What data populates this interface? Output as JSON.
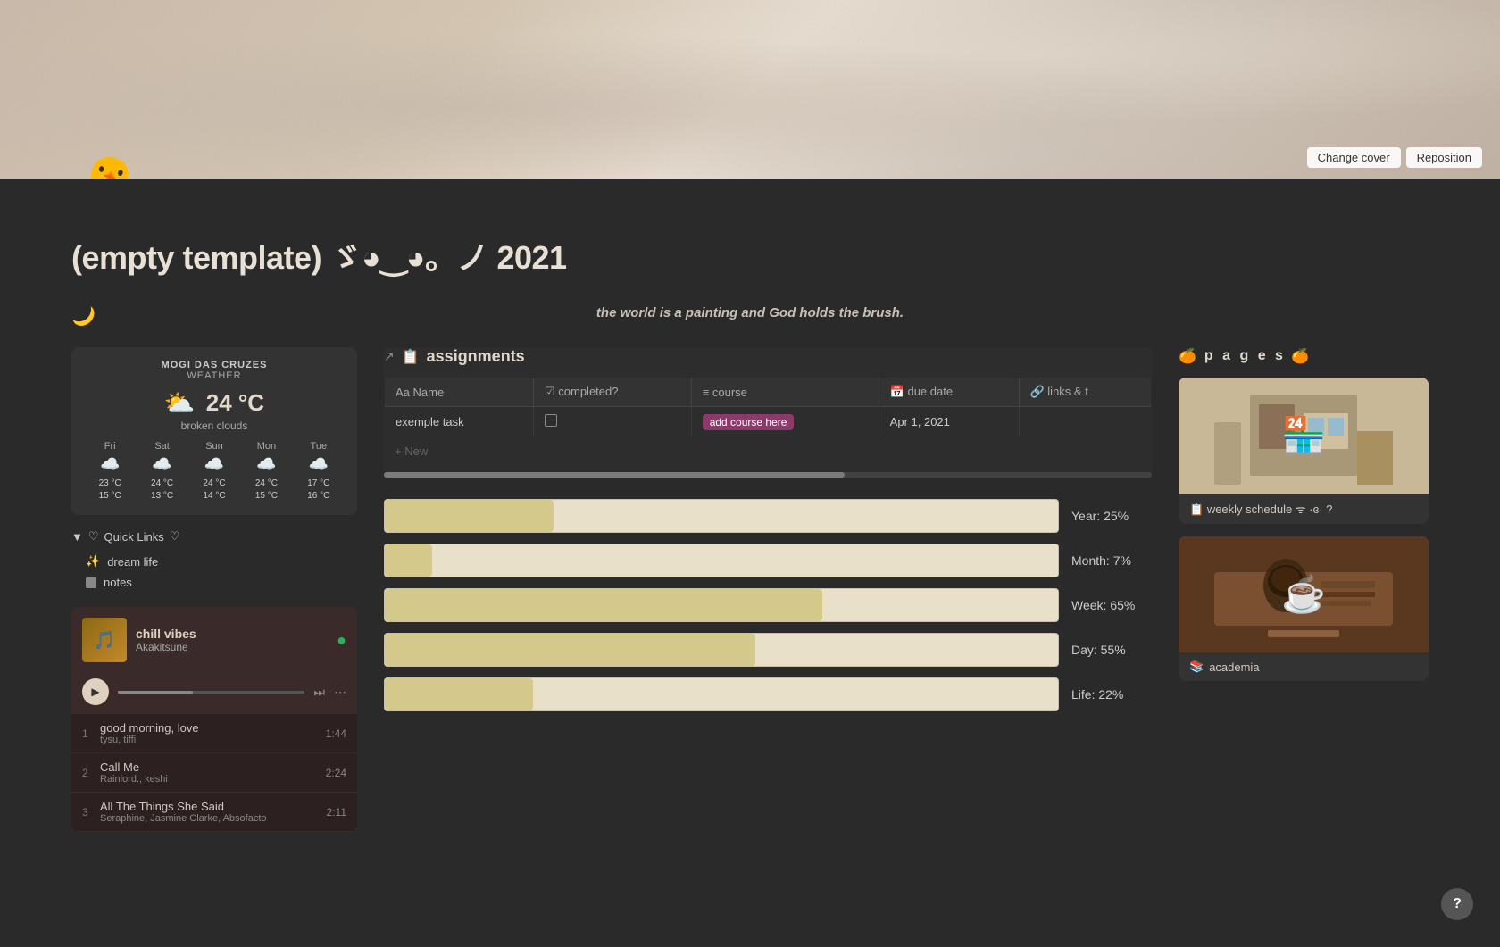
{
  "cover": {
    "change_cover_label": "Change cover",
    "reposition_label": "Reposition"
  },
  "page": {
    "icon": "🐣",
    "title": "(empty template) ゞ◕‿◕。ノ 2021",
    "quote": "the world is a painting and God holds the brush.",
    "moon": "🌙"
  },
  "weather": {
    "location": "MOGI DAS CRUZES",
    "sublabel": "WEATHER",
    "temp": "24 °C",
    "description": "broken clouds",
    "icon": "⛅",
    "days": [
      {
        "name": "Fri",
        "icon": "☁️",
        "high": "23 °C",
        "low": "15 °C"
      },
      {
        "name": "Sat",
        "icon": "☁️",
        "high": "24 °C",
        "low": "13 °C"
      },
      {
        "name": "Sun",
        "icon": "☁️",
        "high": "24 °C",
        "low": "14 °C"
      },
      {
        "name": "Mon",
        "icon": "☁️",
        "high": "24 °C",
        "low": "15 °C"
      },
      {
        "name": "Tue",
        "icon": "☁️",
        "high": "17 °C",
        "low": "16 °C"
      }
    ]
  },
  "quick_links": {
    "title": "Quick Links",
    "items": [
      {
        "label": "dream life",
        "icon": "✨"
      },
      {
        "label": "notes",
        "icon": "■"
      }
    ]
  },
  "music": {
    "title": "chill vibes",
    "artist": "Akakitsune",
    "tracks": [
      {
        "num": "1",
        "name": "good morning, love",
        "artist": "tysu, tiffi",
        "duration": "1:44"
      },
      {
        "num": "2",
        "name": "Call Me",
        "artist": "Rainlord., keshi",
        "duration": "2:24"
      },
      {
        "num": "3",
        "name": "All The Things She Said",
        "artist": "Seraphine, Jasmine Clarke, Absofacto",
        "duration": "2:11"
      }
    ]
  },
  "assignments": {
    "title": "assignments",
    "columns": [
      "Name",
      "completed?",
      "course",
      "due date",
      "links & t"
    ],
    "rows": [
      {
        "name": "exemple task",
        "completed": false,
        "course": "add course here",
        "due_date": "Apr 1, 2021",
        "links": ""
      }
    ],
    "new_label": "+ New"
  },
  "progress": {
    "bars": [
      {
        "label": "Year: 25%",
        "pct": 25
      },
      {
        "label": "Month: 7%",
        "pct": 7
      },
      {
        "label": "Week: 65%",
        "pct": 65
      },
      {
        "label": "Day: 55%",
        "pct": 55
      },
      {
        "label": "Life: 22%",
        "pct": 22
      }
    ]
  },
  "pages": {
    "title": "p a g e s",
    "items": [
      {
        "label": "weekly schedule ᯤ ·ɞ· ?",
        "icon": "📋",
        "type": "cafe"
      },
      {
        "label": "academia",
        "icon": "📚",
        "type": "coffee"
      }
    ]
  },
  "help": {
    "label": "?"
  }
}
